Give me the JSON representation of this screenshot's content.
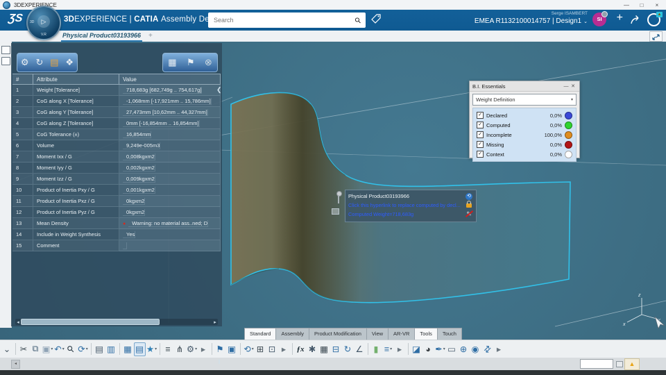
{
  "window": {
    "title": "3DEXPERIENCE",
    "minimize": "—",
    "maximize": "□",
    "close": "×"
  },
  "header": {
    "logo_glyph": "ƷS",
    "compass": {
      "left": "3D",
      "play": "▷",
      "bottom": "V.R"
    },
    "brand": {
      "b1": "3D",
      "r1": "EXPERIENCE",
      "sep": "|",
      "b2": "CATIA",
      "r2": "Assembly Design"
    },
    "search": {
      "placeholder": "Search",
      "mag_glyph": "⚲"
    },
    "user": {
      "name": "Serge ISAMBERT",
      "env": "EMEA R1132100014757 | Design1",
      "chev": "⌄",
      "avatar": "SI"
    },
    "plus": "+"
  },
  "tabrow": {
    "tab": "Physical Product03193966",
    "plus": "+"
  },
  "panel": {
    "tools_left": [
      {
        "glyph": "⚙"
      },
      {
        "glyph": "↻"
      },
      {
        "glyph": "▤",
        "color": "#e8a33d"
      },
      {
        "glyph": "❖"
      }
    ],
    "tools_right": [
      {
        "glyph": "▦"
      },
      {
        "glyph": "⚑"
      },
      {
        "glyph": "⊗",
        "color": "#cdd9e0"
      }
    ],
    "collapse": "❮",
    "grip": "‖",
    "scroll_left": "◂",
    "scroll_right": "▸",
    "table": {
      "headers": {
        "num": "#",
        "attr": "Attribute",
        "value": "Value"
      },
      "rows": [
        {
          "num": "1",
          "attr": "Weight [Tolerance]",
          "value": "718,683g [682,749g .. 754,617g]"
        },
        {
          "num": "2",
          "attr": "CoG along X [Tolerance]",
          "value": "-1,068mm [-17,921mm .. 15,786mm]"
        },
        {
          "num": "3",
          "attr": "CoG along Y [Tolerance]",
          "value": "27,473mm [10,62mm .. 44,327mm]"
        },
        {
          "num": "4",
          "attr": "CoG along Z [Tolerance]",
          "value": "0mm [-16,854mm .. 16,854mm]"
        },
        {
          "num": "5",
          "attr": "CoG Tolerance (±)",
          "value": "16,854mm"
        },
        {
          "num": "6",
          "attr": "Volume",
          "value": "9,249e-005m3"
        },
        {
          "num": "7",
          "attr": "Moment Ixx / G",
          "value": "0,008kgxm2"
        },
        {
          "num": "8",
          "attr": "Moment Iyy / G",
          "value": "0,002kgxm2"
        },
        {
          "num": "9",
          "attr": "Moment Izz / G",
          "value": "0,009kgxm2"
        },
        {
          "num": "10",
          "attr": "Product of Inertia Pxy / G",
          "value": "0,001kgxm2"
        },
        {
          "num": "11",
          "attr": "Product of Inertia Pxz / G",
          "value": "0kgxm2"
        },
        {
          "num": "12",
          "attr": "Product of Inertia Pyz / G",
          "value": "0kgxm2"
        },
        {
          "num": "13",
          "attr": "Mean Density",
          "dot": "●",
          "value": "Warning: no material ass..ned; D"
        },
        {
          "num": "14",
          "attr": "Include in Weight Synthesis",
          "value": "Yes"
        },
        {
          "num": "15",
          "attr": "Comment",
          "value": ""
        }
      ]
    }
  },
  "bi": {
    "title": "B.I. Essentials",
    "minimize": "—",
    "close": "✕",
    "dropdown": {
      "value": "Weight Definition",
      "caret": "▾"
    },
    "rows": [
      {
        "label": "Declared",
        "pct": "0,0%",
        "color": "#3a49d8"
      },
      {
        "label": "Computed",
        "pct": "0,0%",
        "color": "#2fd42f"
      },
      {
        "label": "Incomplete",
        "pct": "100,0%",
        "color": "#df8d1f"
      },
      {
        "label": "Missing",
        "pct": "0,0%",
        "color": "#b21616"
      },
      {
        "label": "Context",
        "pct": "0,0%",
        "color": "#ffffff"
      }
    ]
  },
  "tooltip": {
    "title": "Physical Product03193966",
    "link": "Click this hyperlink to replace computed by decl...",
    "weight": "Computed Weight=718,683g",
    "computed_icon": "⟲"
  },
  "axes": {
    "x": "x",
    "y": "y",
    "z": "z"
  },
  "actionbar": {
    "tabs": [
      {
        "label": "Standard",
        "cls": "active"
      },
      {
        "label": "Assembly"
      },
      {
        "label": "Product Modification"
      },
      {
        "label": "View"
      },
      {
        "label": "AR-VR"
      },
      {
        "label": "Tools",
        "cls": "active"
      },
      {
        "label": "Touch"
      }
    ]
  },
  "toolbar": {
    "icons": [
      {
        "name": "overflow-chevron-icon",
        "glyph": "⌄",
        "color": "#4a5a66"
      },
      {
        "name": "separator",
        "cls": "sep"
      },
      {
        "name": "cut-icon",
        "glyph": "✂",
        "color": "#3a4750"
      },
      {
        "name": "copy-icon",
        "glyph": "⧉",
        "color": "#49637a"
      },
      {
        "name": "paste-icon",
        "glyph": "▣",
        "color": "#8fa3b5",
        "caret": "▾"
      },
      {
        "name": "undo-icon",
        "glyph": "↶",
        "color": "#2e6da4",
        "caret": "▾"
      },
      {
        "name": "search-zoom-icon",
        "glyph": "⚲",
        "color": "#2b3a45",
        "g2": "rot"
      },
      {
        "name": "refresh-icon",
        "glyph": "⟳",
        "color": "#2e6da4",
        "caret": "▾"
      },
      {
        "name": "separator",
        "cls": "sep"
      },
      {
        "name": "print-settings-icon",
        "glyph": "▤",
        "color": "#45586a"
      },
      {
        "name": "report-panel-icon",
        "glyph": "▥",
        "color": "#2e6da4"
      },
      {
        "name": "separator",
        "cls": "sep"
      },
      {
        "name": "table-grid-icon",
        "glyph": "▦",
        "color": "#2e6da4"
      },
      {
        "name": "session-display-icon",
        "glyph": "▤",
        "color": "#2e6da4",
        "cls": "active"
      },
      {
        "name": "favorites-star-icon",
        "glyph": "★",
        "color": "#2f7fb5",
        "caret": "▾"
      },
      {
        "name": "separator",
        "cls": "sep"
      },
      {
        "name": "notes-list-icon",
        "glyph": "≡",
        "color": "#3a4750"
      },
      {
        "name": "flow-tree-icon",
        "glyph": "⋔",
        "color": "#3a4750"
      },
      {
        "name": "settings-panel-icon",
        "glyph": "⚙",
        "color": "#45586a",
        "caret": "▾"
      },
      {
        "name": "more-arrow-icon",
        "glyph": "▸",
        "color": "#6a7680"
      },
      {
        "name": "separator",
        "cls": "sep"
      },
      {
        "name": "bookmark-tree-icon",
        "glyph": "⚑",
        "color": "#2e6da4"
      },
      {
        "name": "pages-stack-icon",
        "glyph": "▣",
        "color": "#2e6da4"
      },
      {
        "name": "separator",
        "cls": "sep"
      },
      {
        "name": "sync-icon",
        "glyph": "⟲",
        "color": "#2e6da4",
        "caret": "▾"
      },
      {
        "name": "select-table-icon",
        "glyph": "⊞",
        "color": "#3a4750"
      },
      {
        "name": "package-icon",
        "glyph": "⊡",
        "color": "#45586a"
      },
      {
        "name": "more-arrow-icon",
        "glyph": "▸",
        "color": "#6a7680"
      },
      {
        "name": "separator",
        "cls": "sep"
      },
      {
        "name": "formula-fx-icon",
        "glyph": "ƒx",
        "color": "#1a2a33",
        "g2": "fx"
      },
      {
        "name": "magic-wand-icon",
        "glyph": "✱",
        "color": "#45586a"
      },
      {
        "name": "design-table-icon",
        "glyph": "▦",
        "color": "#3a4750"
      },
      {
        "name": "table-gear-icon",
        "glyph": "⊟",
        "color": "#2e6da4"
      },
      {
        "name": "box-sync-icon",
        "glyph": "↻",
        "color": "#2e6da4"
      },
      {
        "name": "measure-angle-icon",
        "glyph": "∠",
        "color": "#45586a"
      },
      {
        "name": "separator",
        "cls": "sep"
      },
      {
        "name": "light-toggle-icon",
        "glyph": "▮",
        "color": "#74b06e"
      },
      {
        "name": "filter-panel-icon",
        "glyph": "≡",
        "color": "#2e6da4",
        "caret": "▾"
      },
      {
        "name": "more-arrow-icon",
        "glyph": "▸",
        "color": "#6a7680"
      },
      {
        "name": "separator",
        "cls": "sep"
      },
      {
        "name": "render-style-icon",
        "glyph": "◪",
        "color": "#2e6da4"
      },
      {
        "name": "shading-sphere-icon",
        "glyph": "◕",
        "color": "#3a4045"
      },
      {
        "name": "eyedropper-icon",
        "glyph": "✒",
        "color": "#2e6da4",
        "caret": "▾"
      },
      {
        "name": "eraser-icon",
        "glyph": "▭",
        "color": "#45586a"
      },
      {
        "name": "sphere-add-icon",
        "glyph": "⊕",
        "color": "#2e6da4"
      },
      {
        "name": "sphere-view-icon",
        "glyph": "◉",
        "color": "#2e6da4"
      },
      {
        "name": "expand-arrows-icon",
        "glyph": "⇄",
        "color": "#2e6da4",
        "g2": "rot"
      },
      {
        "name": "more-arrow-icon",
        "glyph": "▸",
        "color": "#6a7680"
      }
    ]
  },
  "statusbar": {
    "left_arrow": "◂",
    "warning": "▲"
  }
}
